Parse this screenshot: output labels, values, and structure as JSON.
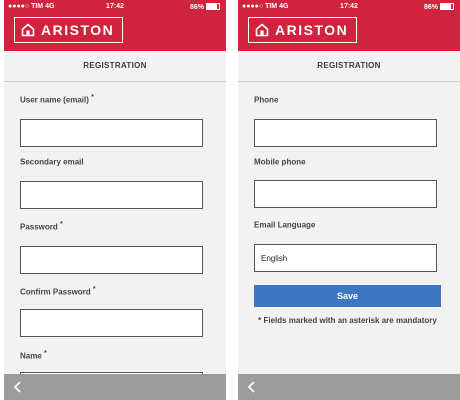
{
  "status_bar": {
    "carrier": "●●●●○ TIM  4G",
    "time": "17:42",
    "battery": "86%"
  },
  "brand": {
    "name": "ARISTON",
    "color": "#d0243e",
    "icon": "home-logo-icon"
  },
  "page_title": "REGISTRATION",
  "screen1": {
    "fields": [
      {
        "label": "User name (email)",
        "required": "*",
        "value": ""
      },
      {
        "label": "Secondary email",
        "required": "",
        "value": ""
      },
      {
        "label": "Password",
        "required": "*",
        "value": ""
      },
      {
        "label": "Confirm Password",
        "required": "*",
        "value": ""
      },
      {
        "label": "Name",
        "required": "*",
        "value": ""
      }
    ]
  },
  "screen2": {
    "fields": [
      {
        "label": "Phone",
        "required": "",
        "value": ""
      },
      {
        "label": "Mobile phone",
        "required": "",
        "value": ""
      },
      {
        "label": "Email Language",
        "required": "",
        "value": "English"
      }
    ],
    "save_label": "Save",
    "note": "* Fields marked with an asterisk are mandatory"
  },
  "footer": {
    "back_icon": "chevron-left-icon"
  },
  "colors": {
    "header": "#d0243e",
    "button": "#3b77c2",
    "footer": "#9c9c9c",
    "background": "#f2f2f2"
  }
}
